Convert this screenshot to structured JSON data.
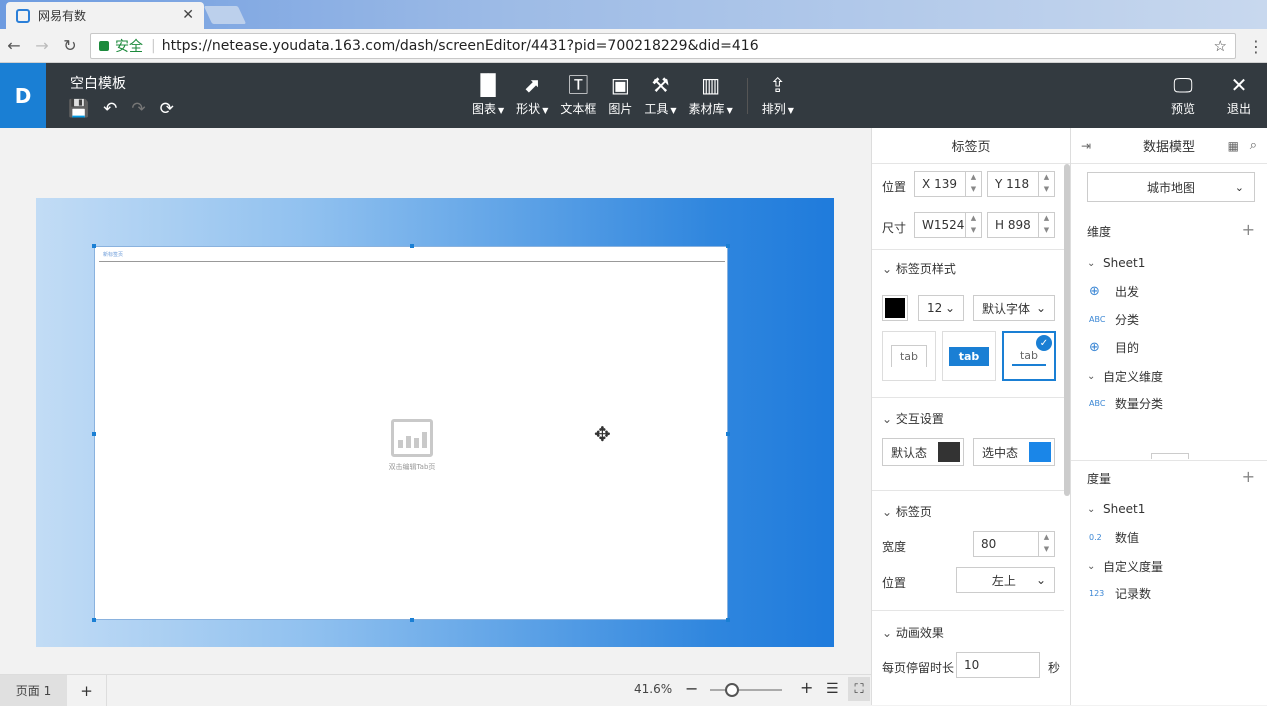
{
  "browser": {
    "tab_title": "网易有数",
    "secure_label": "安全",
    "url": "https://netease.youdata.163.com/dash/screenEditor/4431?pid=700218229&did=416"
  },
  "app": {
    "template_title": "空白模板",
    "toolbar": [
      {
        "label": "图表",
        "icon": "bar-chart-icon",
        "dropdown": true
      },
      {
        "label": "形状",
        "icon": "shape-icon",
        "dropdown": true
      },
      {
        "label": "文本框",
        "icon": "textbox-icon",
        "dropdown": false
      },
      {
        "label": "图片",
        "icon": "image-icon",
        "dropdown": false
      },
      {
        "label": "工具",
        "icon": "hammer-icon",
        "dropdown": true
      },
      {
        "label": "素材库",
        "icon": "library-icon",
        "dropdown": true
      },
      {
        "label": "排列",
        "icon": "arrange-icon",
        "dropdown": true
      }
    ],
    "preview_label": "预览",
    "exit_label": "退出"
  },
  "canvas": {
    "widget_tab_label": "新标签页",
    "placeholder_text": "双击编辑Tab页"
  },
  "footer": {
    "page_label": "页面 1",
    "add_page": "+",
    "zoom": "41.6%",
    "zoom_minus": "−",
    "zoom_plus": "+",
    "zoom_fraction": 0.3
  },
  "properties": {
    "title": "标签页",
    "position_label": "位置",
    "x_prefix": "X",
    "x_value": "139",
    "y_prefix": "Y",
    "y_value": "118",
    "size_label": "尺寸",
    "w_prefix": "W",
    "w_value": "1524",
    "h_prefix": "H",
    "h_value": "898",
    "tab_style_section": "标签页样式",
    "font_color": "#000000",
    "font_size": "12",
    "font_family": "默认字体",
    "style_options": [
      "tab",
      "tab",
      "tab"
    ],
    "selected_style": 2,
    "interaction_section": "交互设置",
    "default_state_label": "默认态",
    "default_state_color": "#333333",
    "selected_state_label": "选中态",
    "selected_state_color": "#1a86e8",
    "tabpage_section": "标签页",
    "width_label": "宽度",
    "width_value": "80",
    "pos_label": "位置",
    "pos_value": "左上",
    "animation_section": "动画效果",
    "dwell_label": "每页停留时长",
    "dwell_value": "10",
    "dwell_unit": "秒"
  },
  "model": {
    "title": "数据模型",
    "dataset": "城市地图",
    "dimension_header": "维度",
    "dimension_group": "Sheet1",
    "dimensions": [
      {
        "type": "globe",
        "label": "出发"
      },
      {
        "type": "ABC",
        "label": "分类"
      },
      {
        "type": "globe",
        "label": "目的"
      }
    ],
    "custom_dimension_group": "自定义维度",
    "custom_dimensions": [
      {
        "type": "ABC",
        "label": "数量分类"
      }
    ],
    "measure_header": "度量",
    "measure_group": "Sheet1",
    "measures": [
      {
        "type": "0.2",
        "label": "数值"
      }
    ],
    "custom_measure_group": "自定义度量",
    "custom_measures": [
      {
        "type": "123",
        "label": "记录数"
      }
    ]
  }
}
